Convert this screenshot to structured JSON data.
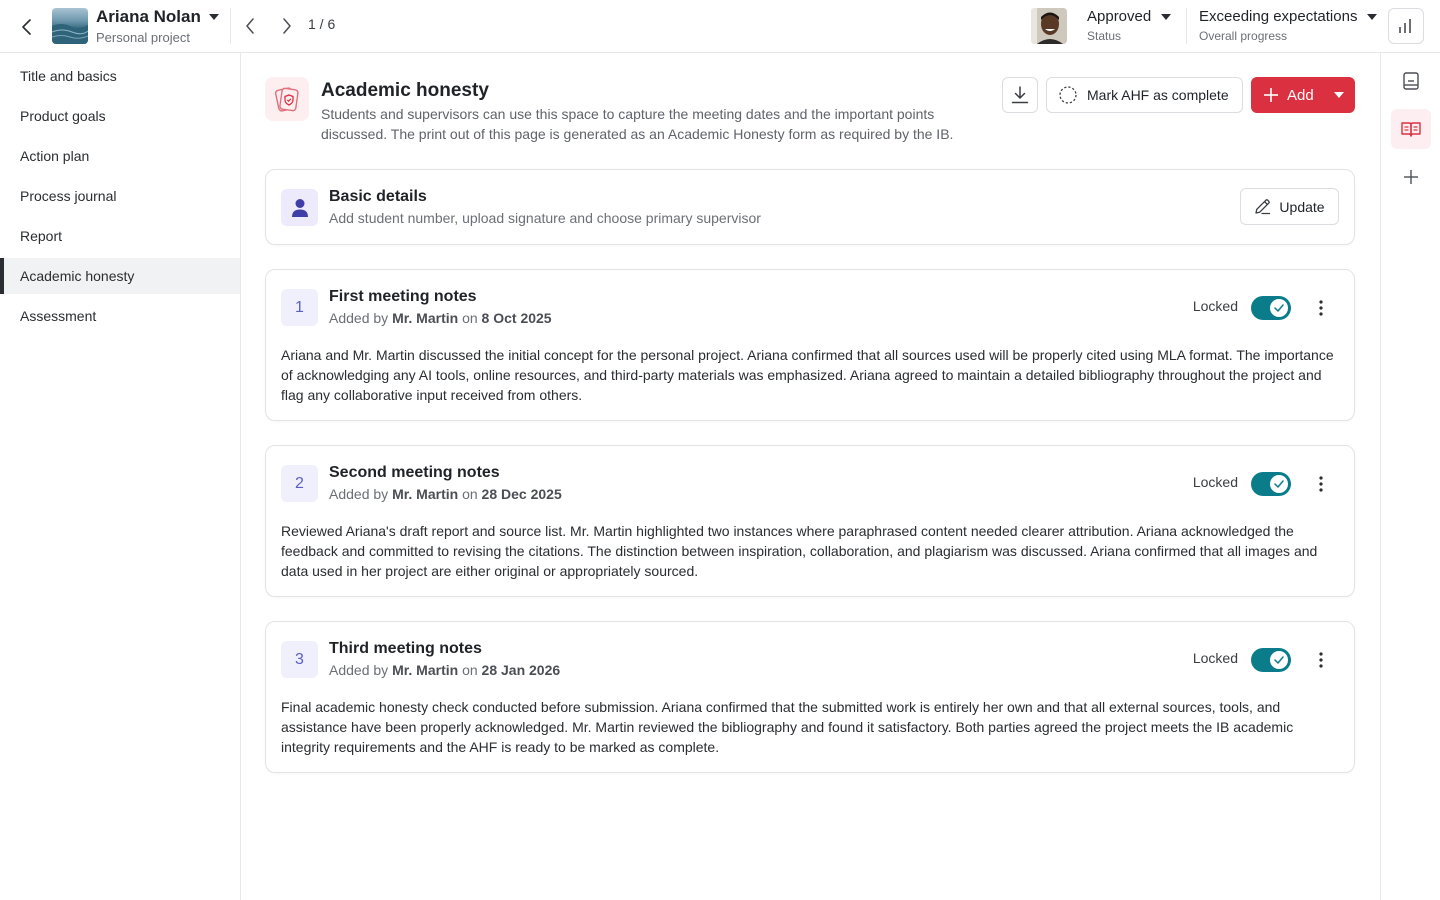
{
  "header": {
    "student_name": "Ariana Nolan",
    "project_type": "Personal project",
    "pager": "1 / 6",
    "status_value": "Approved",
    "status_label": "Status",
    "progress_value": "Exceeding expectations",
    "progress_label": "Overall progress"
  },
  "sidebar": {
    "items": [
      {
        "label": "Title and basics"
      },
      {
        "label": "Product goals"
      },
      {
        "label": "Action plan"
      },
      {
        "label": "Process journal"
      },
      {
        "label": "Report"
      },
      {
        "label": "Academic honesty",
        "active": true
      },
      {
        "label": "Assessment"
      }
    ]
  },
  "page": {
    "title": "Academic honesty",
    "description": "Students and supervisors can use this space to capture the meeting dates and the important points discussed. The print out of this page is generated as an Academic Honesty form as required by the IB.",
    "mark_complete_label": "Mark AHF as complete",
    "add_label": "Add"
  },
  "basic_details": {
    "title": "Basic details",
    "subtitle": "Add student number, upload signature and choose primary supervisor",
    "update_label": "Update"
  },
  "notes": [
    {
      "number": "1",
      "title": "First meeting notes",
      "added_by_prefix": "Added by",
      "author": "Mr. Martin",
      "on": "on",
      "date": "8 Oct 2025",
      "locked_label": "Locked",
      "body": "Ariana and Mr. Martin discussed the initial concept for the personal project. Ariana confirmed that all sources used will be properly cited using MLA format. The importance of acknowledging any AI tools, online resources, and third-party materials was emphasized. Ariana agreed to maintain a detailed bibliography throughout the project and flag any collaborative input received from others."
    },
    {
      "number": "2",
      "title": "Second meeting notes",
      "added_by_prefix": "Added by",
      "author": "Mr. Martin",
      "on": "on",
      "date": "28 Dec 2025",
      "locked_label": "Locked",
      "body": "Reviewed Ariana's draft report and source list. Mr. Martin highlighted two instances where paraphrased content needed clearer attribution. Ariana acknowledged the feedback and committed to revising the citations. The distinction between inspiration, collaboration, and plagiarism was discussed. Ariana confirmed that all images and data used in her project are either original or appropriately sourced."
    },
    {
      "number": "3",
      "title": "Third meeting notes",
      "added_by_prefix": "Added by",
      "author": "Mr. Martin",
      "on": "on",
      "date": "28 Jan 2026",
      "locked_label": "Locked",
      "body": "Final academic honesty check conducted before submission. Ariana confirmed that the submitted work is entirely her own and that all external sources, tools, and assistance have been properly acknowledged. Mr. Martin reviewed the bibliography and found it satisfactory. Both parties agreed the project meets the IB academic integrity requirements and the AHF is ready to be marked as complete."
    }
  ],
  "colors": {
    "accent_red": "#db3040",
    "toggle_teal": "#0b7d8a",
    "number_purple": "#5b5fc7"
  },
  "icons": [
    "chevron-left-icon",
    "caret-down-icon",
    "chevron-right-icon",
    "bar-chart-icon",
    "notebook-icon",
    "open-book-icon",
    "plus-icon",
    "shield-card-icon",
    "download-icon",
    "dashed-circle-icon",
    "user-icon",
    "pencil-icon",
    "check-icon",
    "kebab-icon"
  ]
}
